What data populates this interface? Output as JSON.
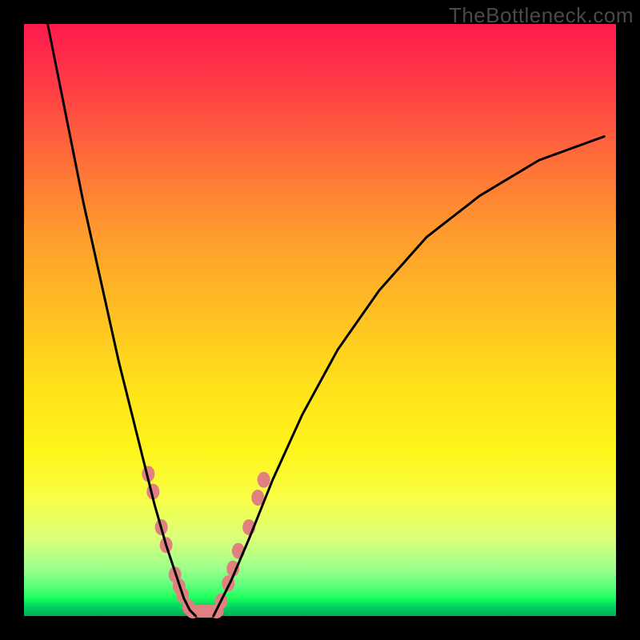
{
  "watermark": "TheBottleneck.com",
  "colors": {
    "frame": "#000000",
    "gradient_top": "#ff1a4d",
    "gradient_mid": "#ffe31a",
    "gradient_bottom": "#00b050",
    "curve": "#000000",
    "marker": "#e08080"
  },
  "chart_data": {
    "type": "line",
    "title": "",
    "xlabel": "",
    "ylabel": "",
    "x_range": [
      0,
      100
    ],
    "y_range": [
      0,
      100
    ],
    "series": [
      {
        "name": "left-branch",
        "x": [
          4,
          6,
          8,
          10,
          12,
          14,
          16,
          18,
          20,
          22,
          24,
          26,
          27,
          28,
          29
        ],
        "y": [
          100,
          90,
          80,
          70,
          61,
          52,
          43,
          35,
          27,
          19,
          12,
          6,
          3,
          1,
          0
        ]
      },
      {
        "name": "right-branch",
        "x": [
          32,
          33,
          35,
          38,
          42,
          47,
          53,
          60,
          68,
          77,
          87,
          98
        ],
        "y": [
          0,
          2,
          6,
          13,
          23,
          34,
          45,
          55,
          64,
          71,
          77,
          81
        ]
      }
    ],
    "markers_left": [
      {
        "x": 21.0,
        "y": 24
      },
      {
        "x": 21.8,
        "y": 21
      },
      {
        "x": 23.2,
        "y": 15
      },
      {
        "x": 24.0,
        "y": 12
      },
      {
        "x": 25.5,
        "y": 7
      },
      {
        "x": 26.2,
        "y": 5
      },
      {
        "x": 26.8,
        "y": 3.5
      },
      {
        "x": 27.8,
        "y": 1.5
      }
    ],
    "markers_right": [
      {
        "x": 33.3,
        "y": 2.5
      },
      {
        "x": 34.5,
        "y": 5.5
      },
      {
        "x": 35.3,
        "y": 8
      },
      {
        "x": 36.2,
        "y": 11
      },
      {
        "x": 38.0,
        "y": 15
      },
      {
        "x": 39.5,
        "y": 20
      },
      {
        "x": 40.5,
        "y": 23
      }
    ],
    "bottom_cluster": {
      "x_start": 28.5,
      "x_end": 32.5,
      "y": 0
    }
  }
}
